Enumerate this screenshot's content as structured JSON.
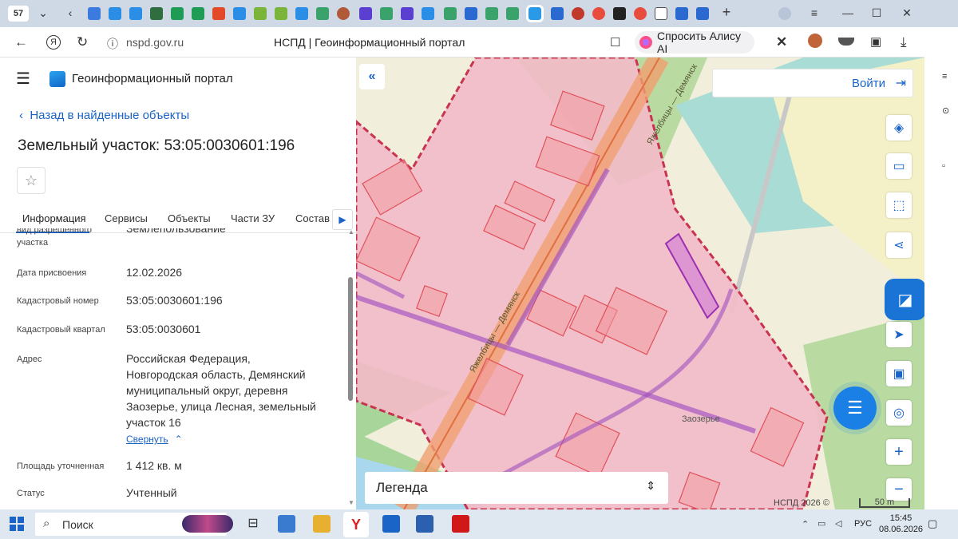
{
  "browser": {
    "tab_count": "57",
    "url": "nspd.gov.ru",
    "page_title": "НСПД | Геоинформационный портал",
    "alice_button": "Спросить Алису AI"
  },
  "portal": {
    "name": "Геоинформационный портал",
    "back_link": "Назад в найденные объекты",
    "object_title": "Земельный участок: 53:05:0030601:196",
    "tabs": [
      "Информация",
      "Сервисы",
      "Объекты",
      "Части ЗУ",
      "Состав"
    ],
    "fields": {
      "cut_label": "вид разрешенного участка",
      "cut_value": "Землепользование",
      "date_label": "Дата присвоения",
      "date_value": "12.02.2026",
      "cadnum_label": "Кадастровый номер",
      "cadnum_value": "53:05:0030601:196",
      "quarter_label": "Кадастровый квартал",
      "quarter_value": "53:05:0030601",
      "address_label": "Адрес",
      "address_lines": [
        "Российская Федерация,",
        "Новгородская область, Демянский",
        "муниципальный округ, деревня",
        "Заозерье, улица Лесная, земельный",
        "участок 16"
      ],
      "collapse_link": "Свернуть",
      "area_label": "Площадь уточненная",
      "area_value": "1 412 кв. м",
      "status_label": "Статус",
      "status_value": "Учтенный"
    }
  },
  "map": {
    "login": "Войти",
    "legend": "Легенда",
    "copyright": "НСПД 2026 ©",
    "scale": "50 m",
    "road_label_1": "Яжелбицы — Демянск",
    "road_label_2": "Яжелбицы — Демянск",
    "place_label": "Заозерье"
  },
  "taskbar": {
    "search": "Поиск",
    "lang": "РУС",
    "time": "15:45",
    "date": "08.06.2026"
  },
  "colors": {
    "accent": "#1a64c8",
    "parcel_fill": "#f0b8c4",
    "parcel_border": "#c8334f",
    "highlight": "#9b30b0"
  }
}
